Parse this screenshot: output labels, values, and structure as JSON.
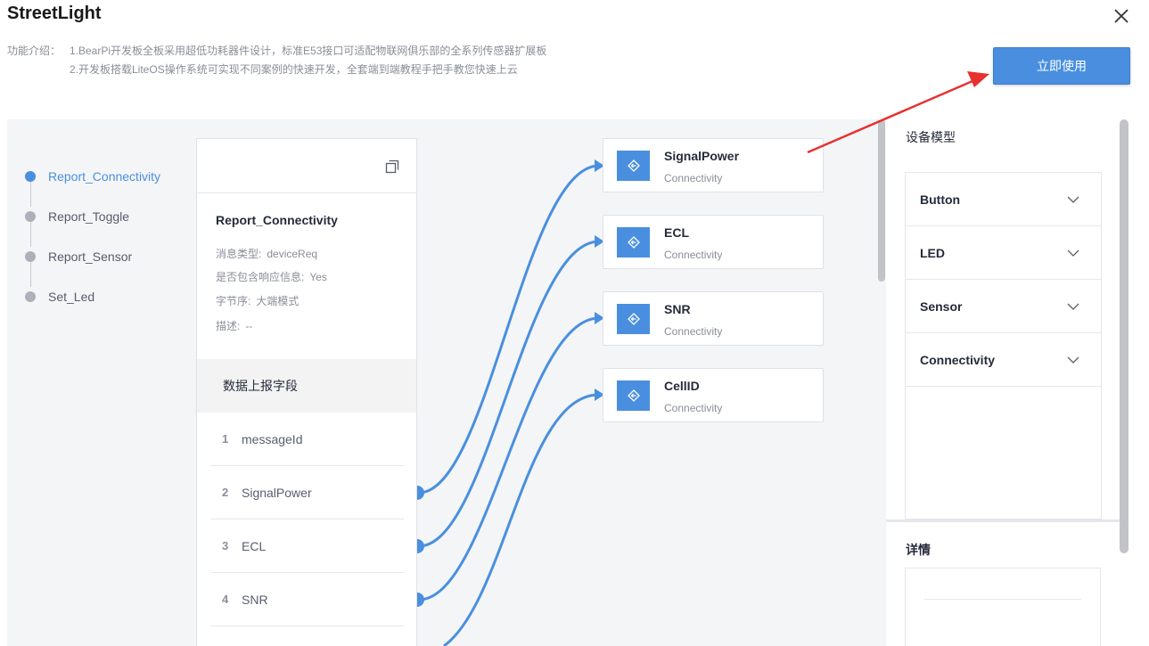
{
  "header": {
    "title": "StreetLight",
    "intro_label": "功能介绍：",
    "intro_lines": [
      "1.BearPi开发板全板采用超低功耗器件设计，标准E53接口可适配物联网俱乐部的全系列传感器扩展板",
      "2.开发板搭载LiteOS操作系统可实现不同案例的快速开发，全套端到端教程手把手教您快速上云"
    ],
    "use_button": "立即使用"
  },
  "steps": [
    {
      "label": "Report_Connectivity",
      "active": true
    },
    {
      "label": "Report_Toggle",
      "active": false
    },
    {
      "label": "Report_Sensor",
      "active": false
    },
    {
      "label": "Set_Led",
      "active": false
    }
  ],
  "message": {
    "name": "Report_Connectivity",
    "attrs": [
      {
        "label": "消息类型:",
        "value": "deviceReq"
      },
      {
        "label": "是否包含响应信息:",
        "value": "Yes"
      },
      {
        "label": "字节序:",
        "value": "大端模式"
      },
      {
        "label": "描述:",
        "value": "--"
      }
    ],
    "fields_title": "数据上报字段",
    "fields": [
      {
        "index": "1",
        "name": "messageId"
      },
      {
        "index": "2",
        "name": "SignalPower"
      },
      {
        "index": "3",
        "name": "ECL"
      },
      {
        "index": "4",
        "name": "SNR"
      }
    ]
  },
  "properties": [
    {
      "name": "SignalPower",
      "type": "Connectivity"
    },
    {
      "name": "ECL",
      "type": "Connectivity"
    },
    {
      "name": "SNR",
      "type": "Connectivity"
    },
    {
      "name": "CellID",
      "type": "Connectivity"
    }
  ],
  "sidebar": {
    "title": "设备模型",
    "services": [
      "Button",
      "LED",
      "Sensor",
      "Connectivity"
    ],
    "detail_title": "详情"
  },
  "colors": {
    "accent": "#4a8fdf",
    "annotation_arrow": "#e8302f"
  }
}
